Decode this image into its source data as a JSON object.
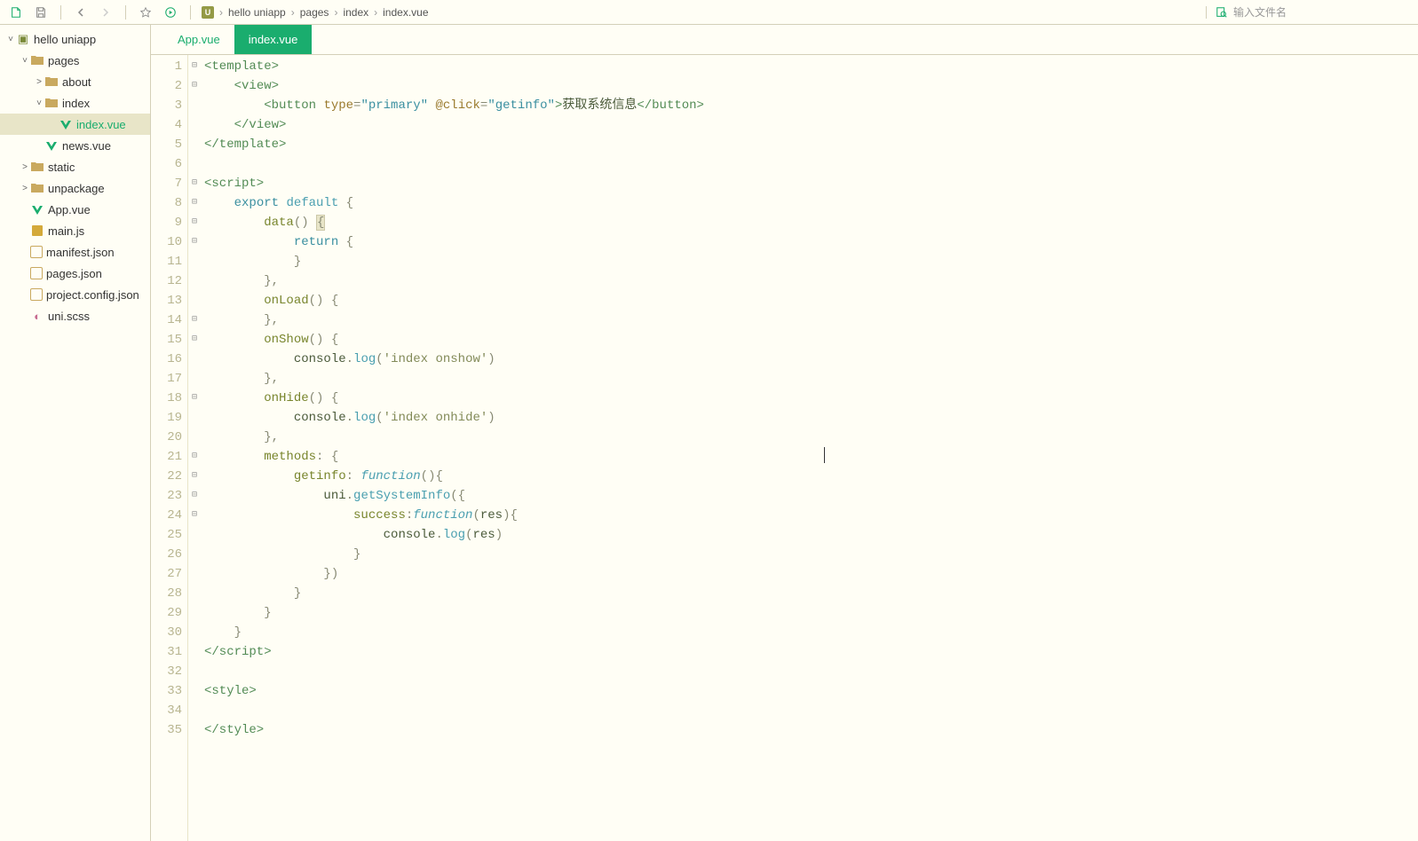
{
  "toolbar": {
    "breadcrumb": [
      "hello uniapp",
      "pages",
      "index",
      "index.vue"
    ],
    "search_placeholder": "输入文件名"
  },
  "sidebar": {
    "root": "hello uniapp",
    "tree": [
      {
        "label": "pages",
        "type": "folder",
        "depth": 1,
        "expanded": true
      },
      {
        "label": "about",
        "type": "folder",
        "depth": 2,
        "expanded": false,
        "chev": ">"
      },
      {
        "label": "index",
        "type": "folder",
        "depth": 2,
        "expanded": true
      },
      {
        "label": "index.vue",
        "type": "vue",
        "depth": 3,
        "active": true,
        "highlight": true
      },
      {
        "label": "news.vue",
        "type": "vue",
        "depth": 2
      },
      {
        "label": "static",
        "type": "folder",
        "depth": 1,
        "expanded": false,
        "chev": ">"
      },
      {
        "label": "unpackage",
        "type": "folder",
        "depth": 1,
        "expanded": false,
        "chev": ">"
      },
      {
        "label": "App.vue",
        "type": "vue",
        "depth": 1
      },
      {
        "label": "main.js",
        "type": "js",
        "depth": 1
      },
      {
        "label": "manifest.json",
        "type": "json",
        "depth": 1
      },
      {
        "label": "pages.json",
        "type": "json",
        "depth": 1
      },
      {
        "label": "project.config.json",
        "type": "json",
        "depth": 1
      },
      {
        "label": "uni.scss",
        "type": "scss",
        "depth": 1
      }
    ]
  },
  "tabs": [
    {
      "label": "App.vue",
      "active": false
    },
    {
      "label": "index.vue",
      "active": true
    }
  ],
  "code": {
    "button_text": "获取系统信息",
    "lines": 35,
    "strings": {
      "primary": "\"primary\"",
      "getinfo_str": "\"getinfo\"",
      "index_onshow": "'index onshow'",
      "index_onhide": "'index onhide'"
    }
  }
}
